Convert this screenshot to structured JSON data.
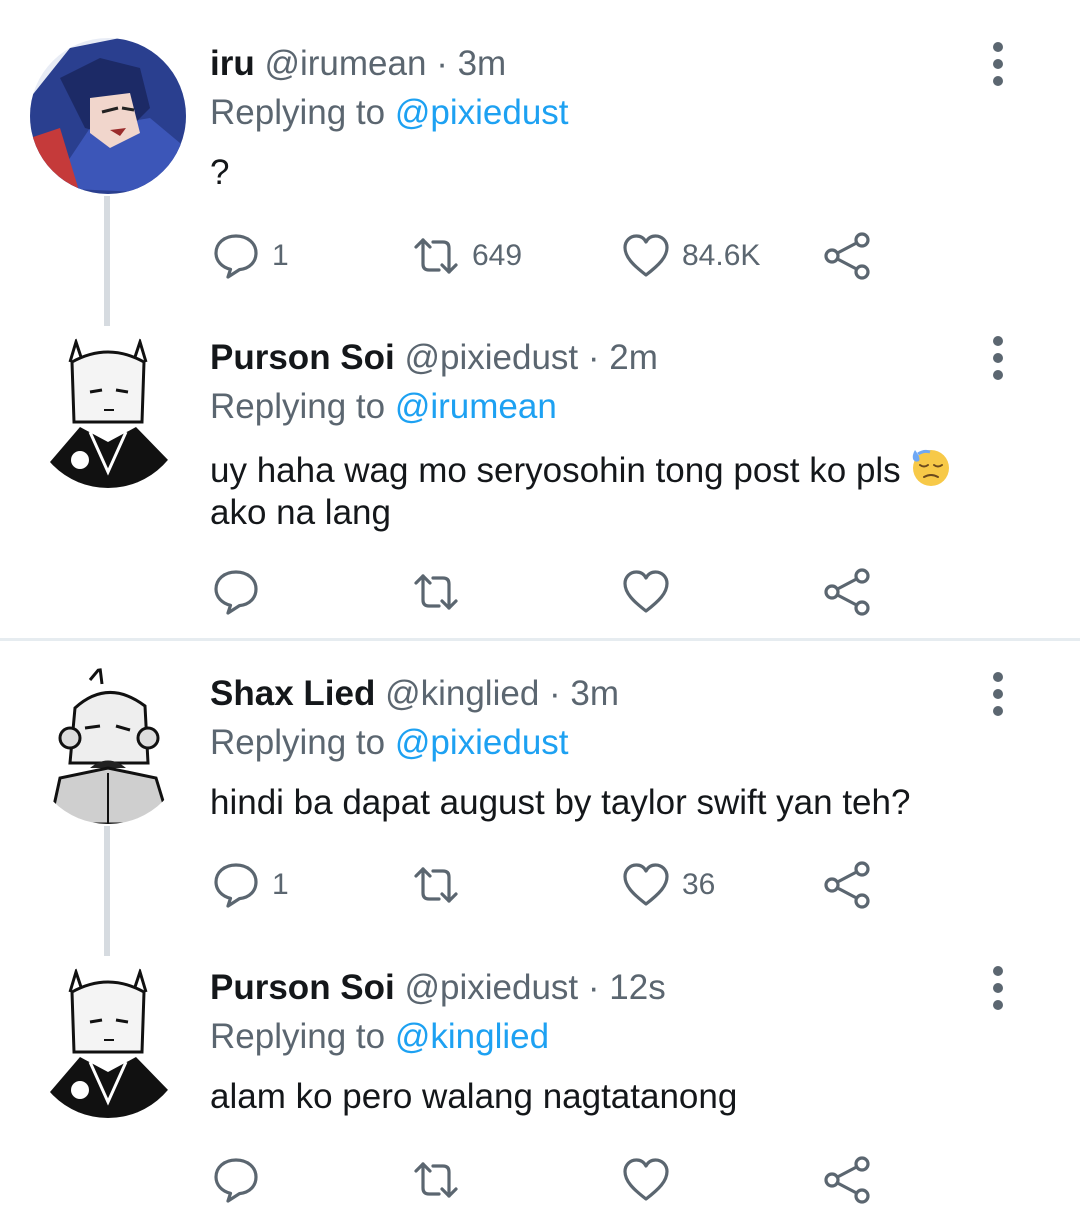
{
  "icons": {
    "reply": "reply-bubble-icon",
    "retweet": "retweet-arrows-icon",
    "like": "heart-icon",
    "share": "share-icon",
    "more": "more-vertical-icon",
    "emoji": "downcast-face-with-sweat-emoji"
  },
  "colors": {
    "mention": "#1da1f2",
    "muted": "#5b6670",
    "thread_line": "#d6dbe0"
  },
  "tweets": [
    {
      "name": "iru",
      "handle": "@irumean",
      "dot": "·",
      "time": "3m",
      "replying_prefix": "Replying to",
      "replying_to": "@pixiedust",
      "text": "?",
      "reply_count": "1",
      "retweet_count": "649",
      "like_count": "84.6K"
    },
    {
      "name": "Purson Soi",
      "handle": "@pixiedust",
      "dot": "·",
      "time": "2m",
      "replying_prefix": "Replying to",
      "replying_to": "@irumean",
      "text_line1": "uy haha wag mo seryosohin tong post ko pls",
      "text_line2": "ako na lang",
      "reply_count": "",
      "retweet_count": "",
      "like_count": ""
    },
    {
      "name": "Shax Lied",
      "handle": "@kinglied",
      "dot": "·",
      "time": "3m",
      "replying_prefix": "Replying to",
      "replying_to": "@pixiedust",
      "text": "hindi ba dapat august by taylor swift yan teh?",
      "reply_count": "1",
      "retweet_count": "",
      "like_count": "36"
    },
    {
      "name": "Purson Soi",
      "handle": "@pixiedust",
      "dot": "·",
      "time": "12s",
      "replying_prefix": "Replying to",
      "replying_to": "@kinglied",
      "text": "alam ko pero walang nagtatanong",
      "reply_count": "",
      "retweet_count": "",
      "like_count": ""
    }
  ]
}
